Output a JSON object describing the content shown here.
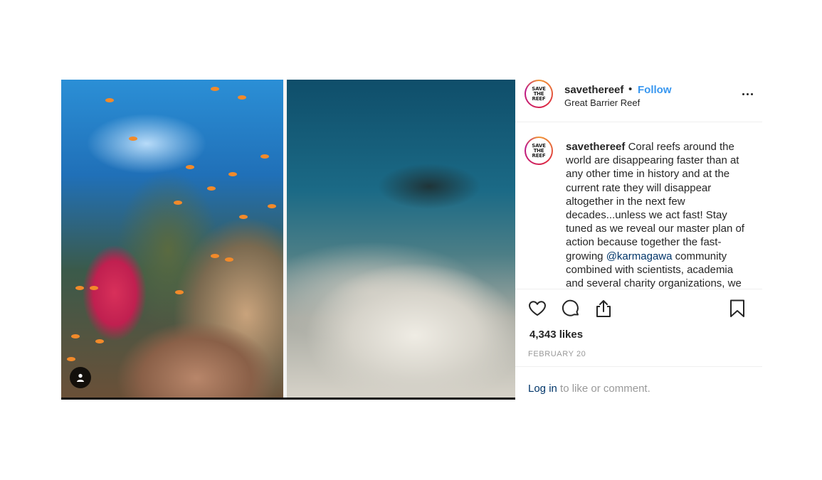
{
  "post": {
    "username": "savethereef",
    "separator": "•",
    "follow_label": "Follow",
    "location": "Great Barrier Reef",
    "avatar_text": [
      "SAVE",
      "THE",
      "REEF"
    ],
    "caption": {
      "username": "savethereef",
      "text_before": "Coral reefs around the world are disappearing faster than at any other time in history and at the current rate they will disappear altogether in the next few decades...unless we act fast! Stay tuned as we reveal our master plan of action because together the fast-growing ",
      "mention": "@karmagawa",
      "text_after": " community combined with scientists, academia and several charity organizations, we"
    },
    "likes": "4,343 likes",
    "date": "FEBRUARY 20",
    "login_link": "Log in",
    "login_rest": " to like or comment."
  },
  "icons": {
    "like": "heart-icon",
    "comment": "comment-icon",
    "share": "share-icon",
    "save": "bookmark-icon",
    "more": "more-options-icon",
    "tag": "user-tag-icon"
  },
  "colors": {
    "link_blue": "#3897f0",
    "mention_blue": "#003569",
    "muted_gray": "#999999",
    "text": "#262626"
  }
}
